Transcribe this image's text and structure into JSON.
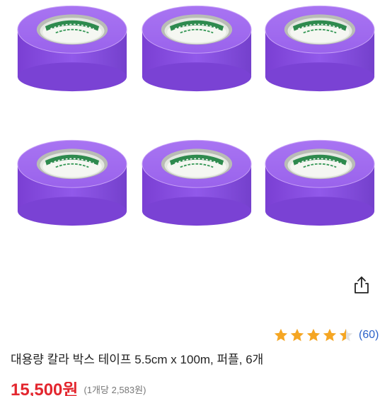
{
  "product": {
    "image_alt": "퍼플 박스 테이프 6개",
    "tape_color": "#8a4fe0",
    "title": "대용량 칼라 박스 테이프 5.5cm x 100m, 퍼플, 6개",
    "rating": {
      "value": 4.5,
      "max": 5,
      "count_label": "(60)"
    },
    "price": "15,500원",
    "unit_price": "(1개당 2,583원)"
  },
  "icons": {
    "share": "share-icon",
    "star": "star-icon"
  },
  "colors": {
    "star": "#f5a623",
    "price": "#e3262e",
    "link": "#2b62c9"
  }
}
